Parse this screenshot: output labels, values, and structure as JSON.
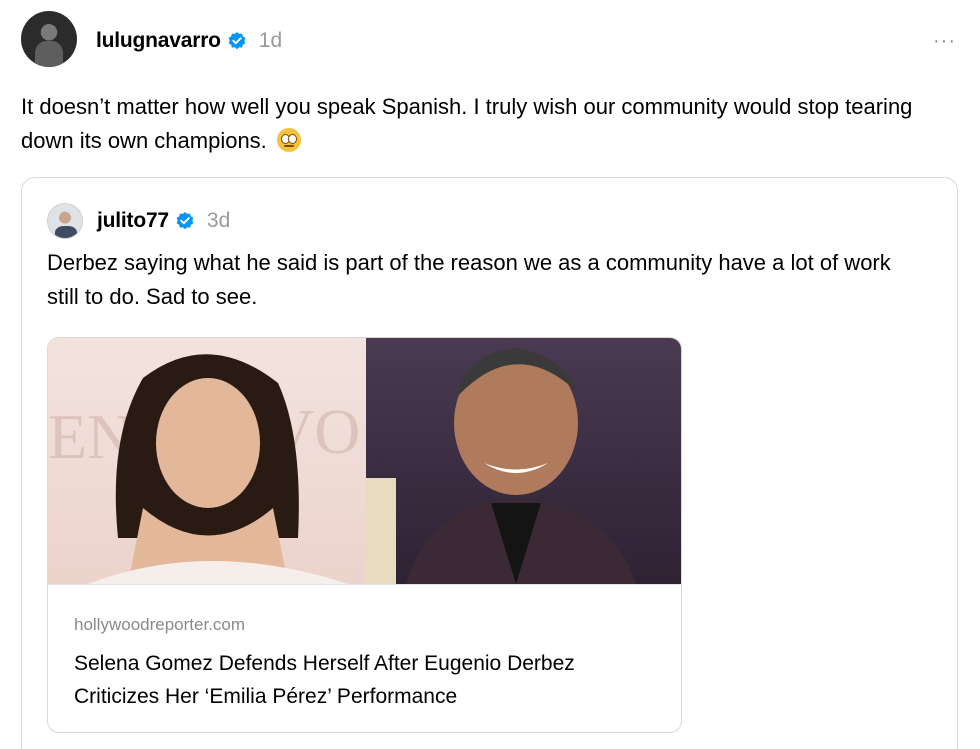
{
  "post": {
    "username": "lulugnavarro",
    "timestamp": "1d",
    "more_label": "···",
    "text": "It doesn’t matter how well you speak Spanish. I truly wish our community would stop tearing down its own champions.",
    "emoji": "face-with-rolling-eyes"
  },
  "quote": {
    "username": "julito77",
    "timestamp": "3d",
    "text": "Derbez saying what he said is part of the reason we as a community have a lot of work still to do. Sad to see.",
    "link": {
      "domain": "hollywoodreporter.com",
      "title": "Selena Gomez Defends Herself After Eugenio Derbez Criticizes Her ‘Emilia Pérez’ Performance"
    }
  },
  "colors": {
    "verified": "#0095f6",
    "muted_text": "#999999",
    "border": "#d9d9d9"
  }
}
